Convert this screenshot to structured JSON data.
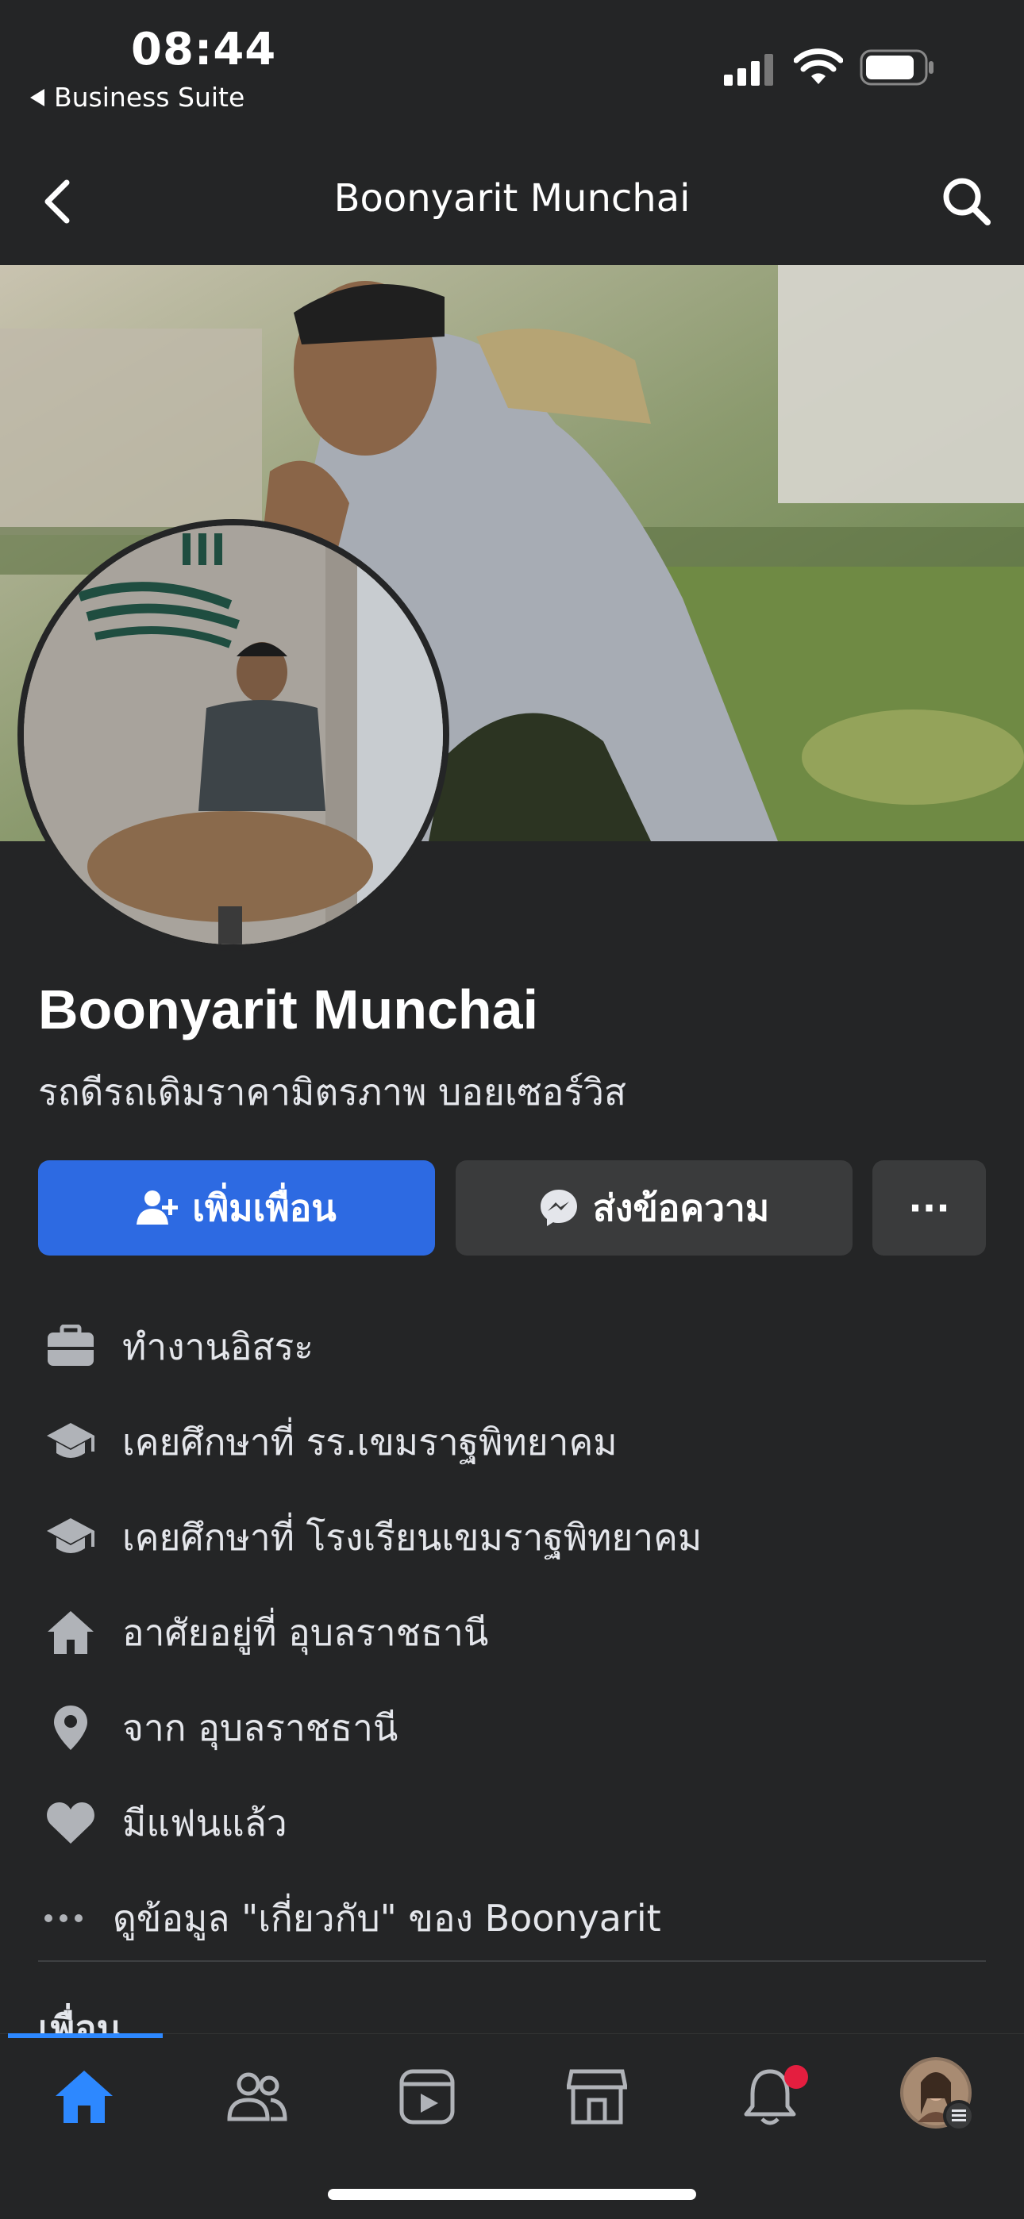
{
  "status_bar": {
    "time": "08:44",
    "back_app": "Business Suite",
    "icons": [
      "signal-icon",
      "wifi-icon",
      "battery-icon"
    ]
  },
  "nav": {
    "title": "Boonyarit Munchai",
    "back_icon": "chevron-left-icon",
    "search_icon": "search-icon"
  },
  "profile": {
    "name": "Boonyarit Munchai",
    "bio": "รถดีรถเดิมราคามิตรภาพ บอยเซอร์วิส"
  },
  "actions": {
    "add_friend": "เพิ่มเพื่อน",
    "message": "ส่งข้อความ",
    "more": "···"
  },
  "intro": [
    {
      "icon": "briefcase-icon",
      "text": "ทำงานอิสระ"
    },
    {
      "icon": "graduation-cap-icon",
      "text": "เคยศึกษาที่ รร.เขมราฐพิทยาคม"
    },
    {
      "icon": "graduation-cap-icon",
      "text": "เคยศึกษาที่ โรงเรียนเขมราฐพิทยาคม"
    },
    {
      "icon": "home-icon",
      "text": "อาศัยอยู่ที่ อุบลราชธานี"
    },
    {
      "icon": "location-pin-icon",
      "text": "จาก อุบลราชธานี"
    },
    {
      "icon": "heart-icon",
      "text": "มีแฟนแล้ว"
    }
  ],
  "about_link": "ดูข้อมูล \"เกี่ยวกับ\" ของ Boonyarit",
  "friends_heading": "เพื่อน",
  "tabbar": {
    "tabs": [
      "home-tab",
      "friends-tab",
      "watch-tab",
      "marketplace-tab",
      "notifications-tab",
      "profile-menu-tab"
    ],
    "active": "home-tab",
    "accent": "#2d88ff",
    "notification_dot_color": "#e41e3f"
  },
  "colors": {
    "background": "#242526",
    "primary_button": "#2d6ae2",
    "secondary_button": "#3a3b3c"
  }
}
